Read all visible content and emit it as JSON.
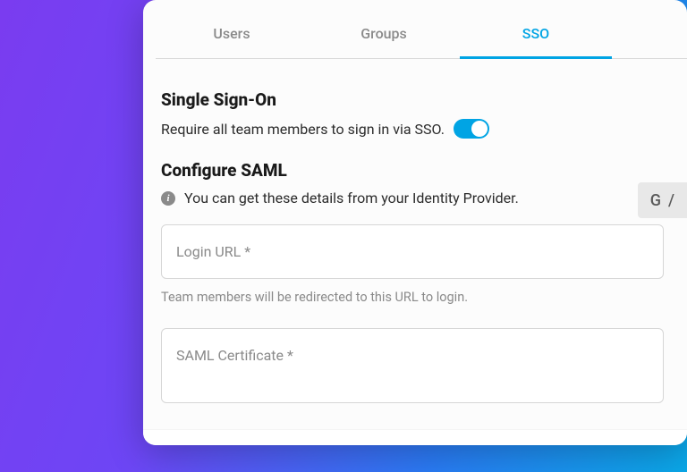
{
  "tabs": [
    {
      "label": "Users"
    },
    {
      "label": "Groups"
    },
    {
      "label": "SSO"
    }
  ],
  "sso": {
    "heading": "Single Sign-On",
    "require_label": "Require all team members to sign in via SSO.",
    "require_enabled": true
  },
  "saml": {
    "heading": "Configure SAML",
    "info_text": "You can get these details from your Identity Provider.",
    "provider_chip_letter": "G",
    "login_url": {
      "placeholder": "Login URL *",
      "value": "",
      "helper": "Team members will be redirected to this URL to login."
    },
    "certificate": {
      "placeholder": "SAML Certificate *",
      "value": ""
    }
  }
}
